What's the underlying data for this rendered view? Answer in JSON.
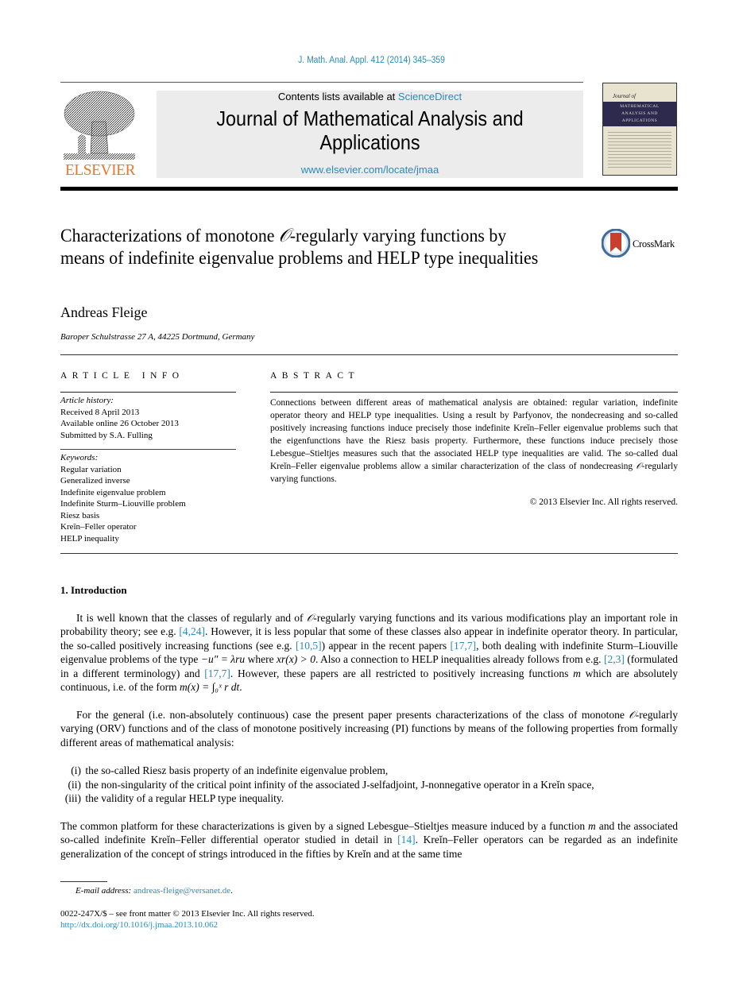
{
  "header": {
    "journal_ref": "J. Math. Anal. Appl. 412 (2014) 345–359",
    "publisher_logo_text": "ELSEVIER",
    "contents_prefix": "Contents lists available at ",
    "contents_link": "ScienceDirect",
    "journal_title_line1": "Journal of Mathematical Analysis and",
    "journal_title_line2": "Applications",
    "journal_url": "www.elsevier.com/locate/jmaa",
    "cover": {
      "journal_of": "Journal of",
      "line1": "MATHEMATICAL",
      "line2": "ANALYSIS AND",
      "line3": "APPLICATIONS"
    }
  },
  "article": {
    "title_part1": "Characterizations of monotone ",
    "title_symbol": "𝒪",
    "title_part2": "-regularly varying functions by means of indefinite eigenvalue problems and HELP type inequalities",
    "crossmark_label": "CrossMark",
    "author": "Andreas Fleige",
    "affiliation": "Baroper Schulstrasse 27 A, 44225 Dortmund, Germany"
  },
  "article_info": {
    "heading": "ARTICLE INFO",
    "history_label": "Article history:",
    "history": [
      "Received 8 April 2013",
      "Available online 26 October 2013",
      "Submitted by S.A. Fulling"
    ],
    "keywords_label": "Keywords:",
    "keywords": [
      "Regular variation",
      "Generalized inverse",
      "Indefinite eigenvalue problem",
      "Indefinite Sturm–Liouville problem",
      "Riesz basis",
      "Kreĭn–Feller operator",
      "HELP inequality"
    ]
  },
  "abstract": {
    "heading": "ABSTRACT",
    "text_part1": "Connections between different areas of mathematical analysis are obtained: regular variation, indefinite operator theory and HELP type inequalities. Using a result by Parfyonov, the nondecreasing and so-called positively increasing functions induce precisely those indefinite Kreĭn–Feller eigenvalue problems such that the eigenfunctions have the Riesz basis property. Furthermore, these functions induce precisely those Lebesgue–Stieltjes measures such that the associated HELP type inequalities are valid. The so-called dual Kreĭn–Feller eigenvalue problems allow a similar characterization of the class of nondecreasing ",
    "text_symbol": "𝒪",
    "text_part2": "-regularly varying functions.",
    "copyright": "© 2013 Elsevier Inc. All rights reserved."
  },
  "intro": {
    "heading": "1. Introduction",
    "p1": {
      "a": "It is well known that the classes of regularly and of ",
      "sym": "𝒪",
      "b": "-regularly varying functions and its various modifications play an important role in probability theory; see e.g. ",
      "ref1": "[4,24]",
      "c": ". However, it is less popular that some of these classes also appear in indefinite operator theory. In particular, the so-called positively increasing functions (see e.g. ",
      "ref2": "[10,5]",
      "d": ") appear in the recent papers ",
      "ref3": "[17,7]",
      "e": ", both dealing with indefinite Sturm–Liouville eigenvalue problems of the type ",
      "eq1": "−u″ = λru",
      "f": " where ",
      "eq2": "xr(x) > 0",
      "g": ". Also a connection to HELP inequalities already follows from e.g. ",
      "ref4": "[2,3]",
      "h": " (formulated in a different terminology) and ",
      "ref5": "[17,7]",
      "i": ". However, these papers are all restricted to positively increasing functions ",
      "var_m": "m",
      "j": " which are absolutely continuous, i.e. of the form ",
      "eq3": "m(x) = ∫₀ˣ r dt",
      "k": "."
    },
    "p2": {
      "a": "For the general (i.e. non-absolutely continuous) case the present paper presents characterizations of the class of monotone ",
      "sym": "𝒪",
      "b": "-regularly varying (ORV) functions and of the class of monotone positively increasing (PI) functions by means of the following properties from formally different areas of mathematical analysis:"
    },
    "list": [
      {
        "num": "(i)",
        "text": "the so-called Riesz basis property of an indefinite eigenvalue problem,"
      },
      {
        "num": "(ii)",
        "text": "the non-singularity of the critical point infinity of the associated J-selfadjoint, J-nonnegative operator in a Kreĭn space,"
      },
      {
        "num": "(iii)",
        "text": "the validity of a regular HELP type inequality."
      }
    ],
    "p3": {
      "a": "The common platform for these characterizations is given by a signed Lebesgue–Stieltjes measure induced by a function ",
      "var_m": "m",
      "b": " and the associated so-called indefinite Kreĭn–Feller differential operator studied in detail in ",
      "ref": "[14]",
      "c": ". Kreĭn–Feller operators can be regarded as an indefinite generalization of the concept of strings introduced in the fifties by Kreĭn and at the same time"
    }
  },
  "footer": {
    "email_label": "E-mail address: ",
    "email": "andreas-fleige@versanet.de",
    "email_end": ".",
    "front_matter": "0022-247X/$ – see front matter  © 2013 Elsevier Inc. All rights reserved.",
    "doi": "http://dx.doi.org/10.1016/j.jmaa.2013.10.062"
  },
  "colors": {
    "link": "#2a8ab8",
    "elsevier_orange": "#e8772e",
    "banner_gray": "#ececec"
  }
}
